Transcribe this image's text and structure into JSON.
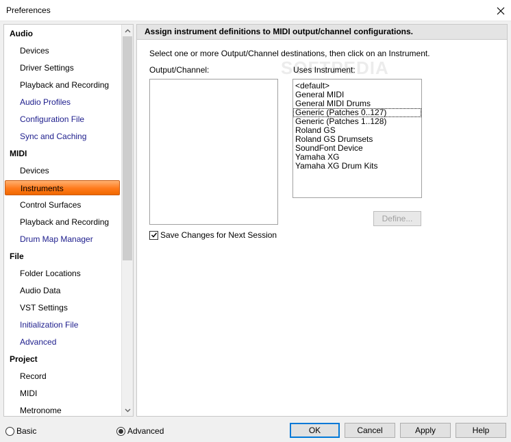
{
  "window": {
    "title": "Preferences"
  },
  "nav": {
    "items": [
      {
        "label": "Audio",
        "type": "header"
      },
      {
        "label": "Devices",
        "type": "child"
      },
      {
        "label": "Driver Settings",
        "type": "child"
      },
      {
        "label": "Playback and Recording",
        "type": "child"
      },
      {
        "label": "Audio Profiles",
        "type": "link"
      },
      {
        "label": "Configuration File",
        "type": "link"
      },
      {
        "label": "Sync and Caching",
        "type": "link"
      },
      {
        "label": "MIDI",
        "type": "header"
      },
      {
        "label": "Devices",
        "type": "child"
      },
      {
        "label": "Instruments",
        "type": "selected"
      },
      {
        "label": "Control Surfaces",
        "type": "child"
      },
      {
        "label": "Playback and Recording",
        "type": "child"
      },
      {
        "label": "Drum Map Manager",
        "type": "link"
      },
      {
        "label": "File",
        "type": "header"
      },
      {
        "label": "Folder Locations",
        "type": "child"
      },
      {
        "label": "Audio Data",
        "type": "child"
      },
      {
        "label": "VST Settings",
        "type": "child"
      },
      {
        "label": "Initialization File",
        "type": "link"
      },
      {
        "label": "Advanced",
        "type": "link"
      },
      {
        "label": "Project",
        "type": "header"
      },
      {
        "label": "Record",
        "type": "child"
      },
      {
        "label": "MIDI",
        "type": "child"
      },
      {
        "label": "Metronome",
        "type": "child"
      }
    ]
  },
  "main": {
    "header": "Assign instrument definitions to MIDI output/channel configurations.",
    "instruction": "Select one or more Output/Channel destinations, then click on an Instrument.",
    "output_channel_label": "Output/Channel:",
    "uses_instrument_label": "Uses Instrument:",
    "instruments": [
      "<default>",
      "General MIDI",
      "General MIDI Drums",
      "Generic (Patches 0..127)",
      "Generic (Patches 1..128)",
      "Roland GS",
      "Roland GS Drumsets",
      "SoundFont Device",
      "Yamaha XG",
      "Yamaha XG Drum Kits"
    ],
    "focused_instrument": "Generic (Patches 0..127)",
    "define_label": "Define...",
    "save_changes_label": "Save Changes for Next Session",
    "save_changes_checked": true,
    "watermark": "SOFTPEDIA"
  },
  "footer": {
    "basic_label": "Basic",
    "advanced_label": "Advanced",
    "mode_selected": "Advanced",
    "ok_label": "OK",
    "cancel_label": "Cancel",
    "apply_label": "Apply",
    "help_label": "Help"
  },
  "colors": {
    "selection": "#ff7a1a",
    "link": "#1c1c8c",
    "default_button_border": "#0078d7"
  }
}
